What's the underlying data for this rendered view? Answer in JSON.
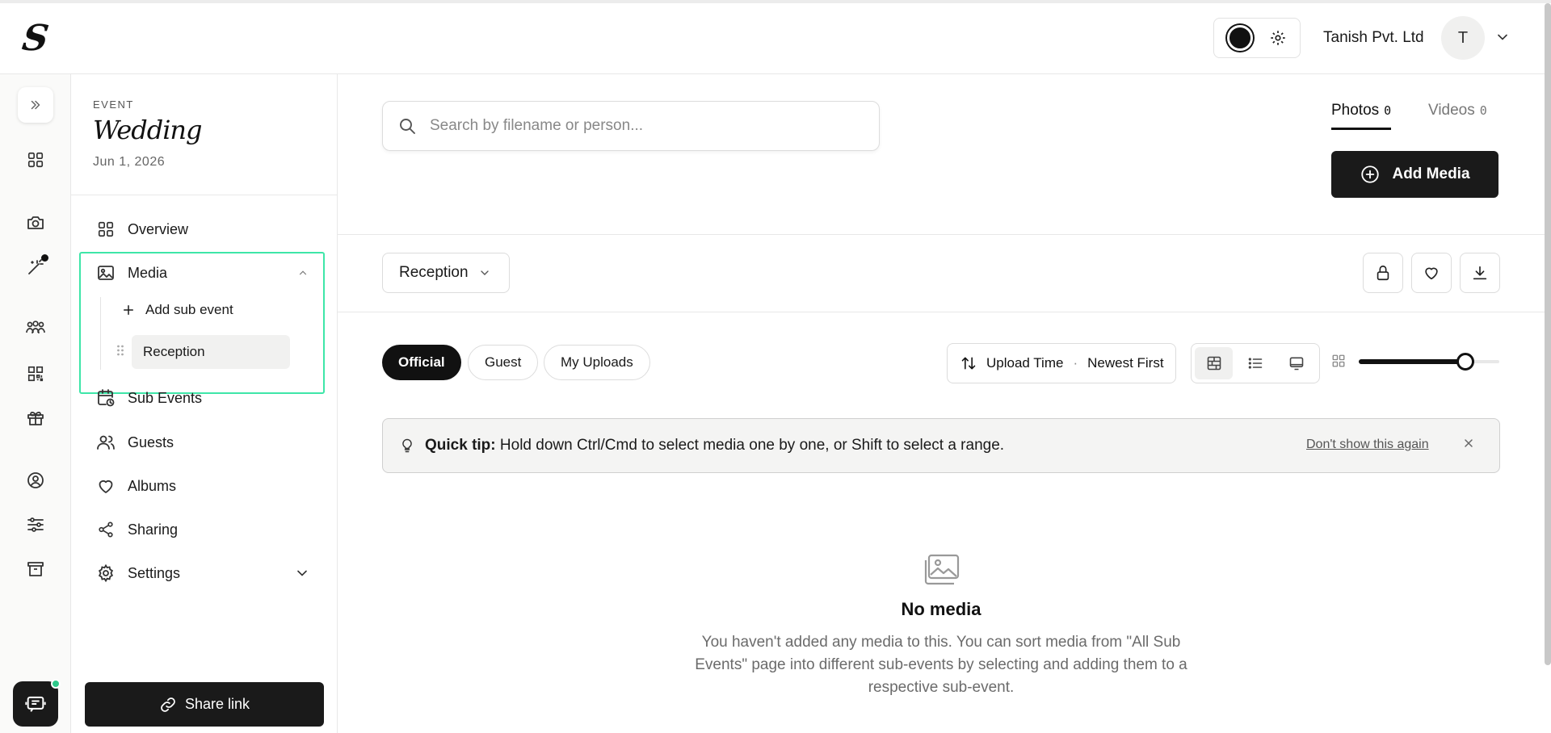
{
  "brand": {
    "logo_letter": "S"
  },
  "header": {
    "org_name": "Tanish Pvt. Ltd",
    "avatar_initial": "T"
  },
  "event": {
    "kicker": "EVENT",
    "title": "Wedding",
    "date": "Jun 1, 2026"
  },
  "sidebar": {
    "items": [
      {
        "label": "Overview",
        "icon": "grid-icon"
      },
      {
        "label": "Media",
        "icon": "image-icon"
      },
      {
        "label": "Sub Events",
        "icon": "calendar-clock-icon"
      },
      {
        "label": "Guests",
        "icon": "users-icon"
      },
      {
        "label": "Albums",
        "icon": "heart-icon"
      },
      {
        "label": "Sharing",
        "icon": "share-nodes-icon"
      },
      {
        "label": "Settings",
        "icon": "gear-icon"
      }
    ],
    "media_children": {
      "add_label": "Add sub event",
      "sub_events": [
        "Reception"
      ]
    },
    "share_button": "Share link"
  },
  "search": {
    "placeholder": "Search by filename or person..."
  },
  "media_tabs": [
    {
      "label": "Photos",
      "count": "0",
      "active": true
    },
    {
      "label": "Videos",
      "count": "0",
      "active": false
    }
  ],
  "add_media_label": "Add Media",
  "subevent_select": {
    "value": "Reception"
  },
  "filters": {
    "pills": [
      {
        "label": "Official",
        "active": true
      },
      {
        "label": "Guest",
        "active": false
      },
      {
        "label": "My Uploads",
        "active": false
      }
    ],
    "sort_field": "Upload Time",
    "sort_separator": "·",
    "sort_order": "Newest First",
    "thumbnail_size_fraction": 0.76
  },
  "tip": {
    "bold": "Quick tip:",
    "text": "Hold down Ctrl/Cmd to select media one by one, or Shift to select a range.",
    "dismiss": "Don't show this again"
  },
  "empty_state": {
    "title": "No media",
    "text": "You haven't added any media to this. You can sort media from \"All Sub Events\" page into different sub-events by selecting and adding them to a respective sub-event."
  },
  "colors": {
    "primary": "#1a1a1a",
    "focus_outline": "#3ee6a8",
    "notification_dot": "#2ec98a"
  }
}
